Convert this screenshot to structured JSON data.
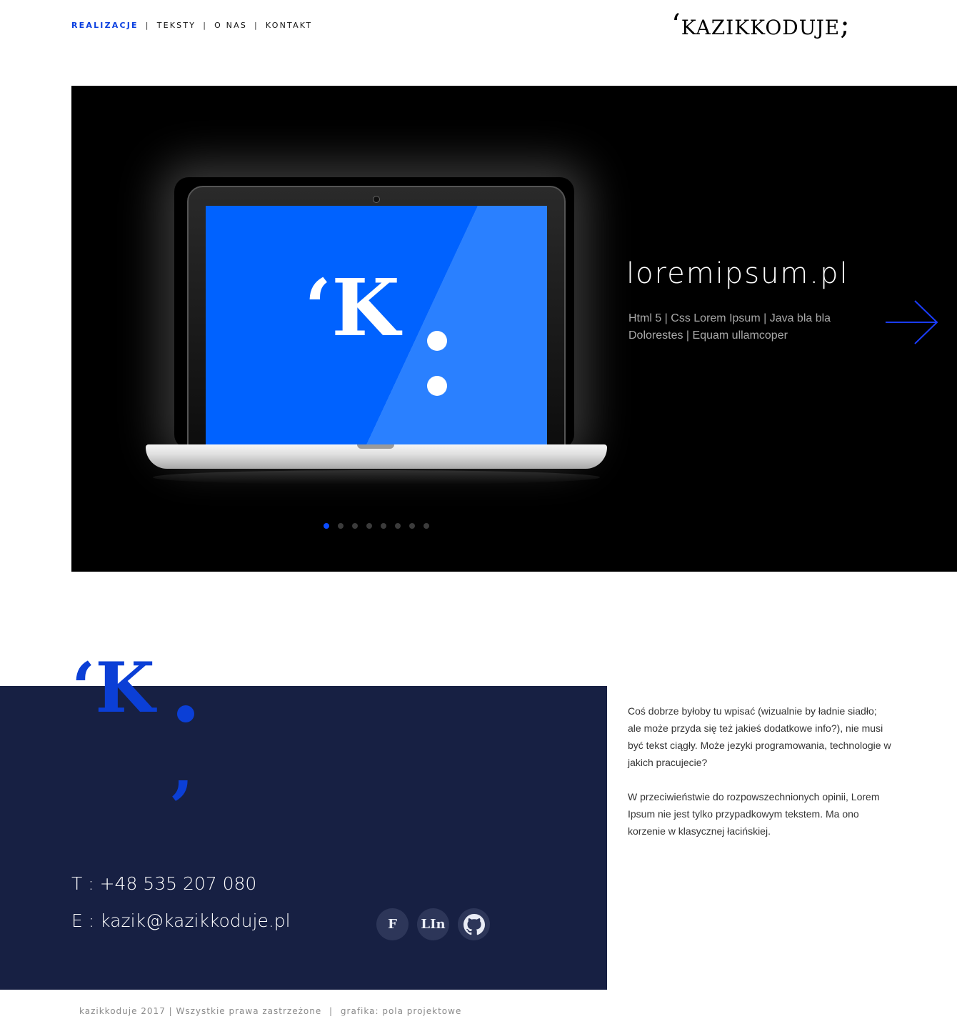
{
  "nav": {
    "items": [
      {
        "label": "REALIZACJE",
        "active": true
      },
      {
        "label": "TEKSTY",
        "active": false
      },
      {
        "label": "O NAS",
        "active": false
      },
      {
        "label": "KONTAKT",
        "active": false
      }
    ],
    "brand": "‘kazikkoduje;"
  },
  "hero": {
    "title": "loremipsum.pl",
    "tags_line1": "Html 5  |  Css Lorem Ipsum  |  Java bla bla",
    "tags_line2": "Dolorestes  |  Equam ullamcoper",
    "screen_mark": "‘K",
    "slide_count": 8,
    "active_slide": 1,
    "arrow_icon": "arrow-right-icon",
    "accent_color": "#0a4bff"
  },
  "contact": {
    "phone": "T : +48 535 207 080",
    "email": "E : kazik@kazikkoduje.pl",
    "logo_mark": "‘K",
    "socials": [
      {
        "label": "F",
        "icon": "facebook-icon"
      },
      {
        "label": "LIn",
        "icon": "linkedin-icon"
      },
      {
        "label": "",
        "icon": "github-icon"
      }
    ],
    "panel_color": "#172043"
  },
  "about": {
    "paragraph1": "Coś dobrze byłoby tu wpisać (wizualnie by ładnie siadło; ale może przyda się też jakieś dodatkowe info?), nie musi być tekst ciągły. Może jezyki programowania, technologie w jakich pracujecie?",
    "paragraph2": "W przeciwieństwie do rozpowszechnionych opinii, Lorem Ipsum nie jest tylko przypadkowym tekstem. Ma ono korzenie w klasycznej łacińskiej."
  },
  "footer": {
    "copyright": "kazikkoduje 2017 |",
    "rights": "Wszystkie prawa zastrzeżone",
    "credits": "grafika: pola projektowe"
  }
}
